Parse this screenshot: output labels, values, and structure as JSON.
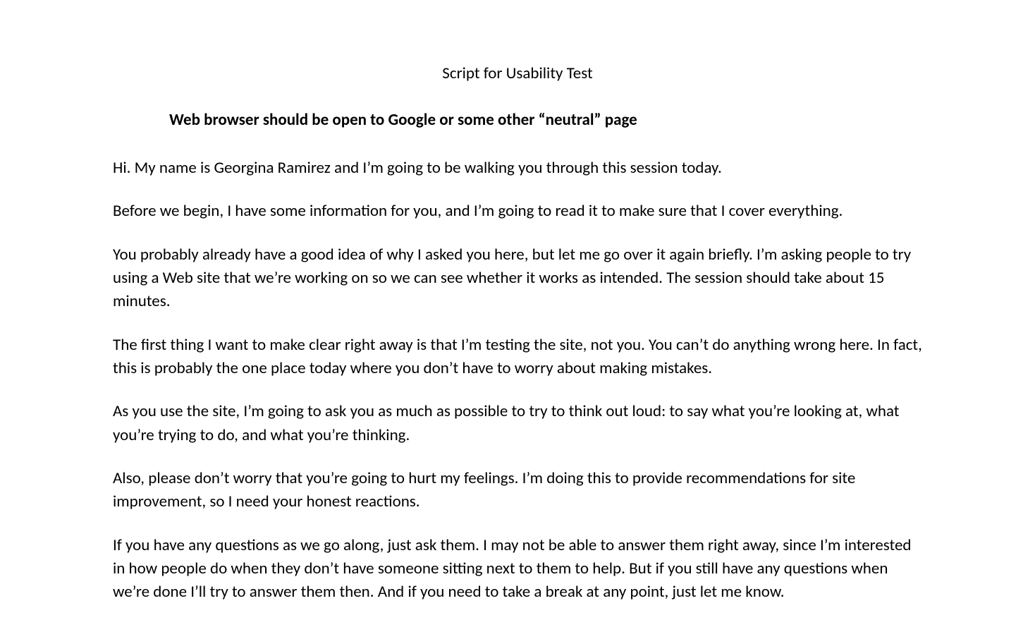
{
  "title": "Script for Usability Test",
  "instruction": "Web browser should be open to Google or some other “neutral” page",
  "paragraphs": [
    "Hi. My name is Georgina Ramirez and I’m going to be walking you through this session today.",
    "Before we begin, I have some information for you, and I’m going to read it to make sure that I cover everything.",
    "You probably already have a good idea of why I asked you here, but let me go over it again briefly. I’m asking people to try using a Web site that we’re working on so we can see whether it works as intended. The session should take about 15 minutes.",
    "The first thing I want to make clear right away is that I’m testing the site, not you. You can’t do anything wrong here. In fact, this is probably the one place today where you don’t have to worry about making mistakes.",
    "As you use the site, I’m going to ask you as much as possible to try to think out loud: to say what you’re looking at, what you’re trying to do, and what you’re thinking.",
    "Also, please don’t worry that you’re going to hurt my feelings. I’m doing this to provide recommendations for site improvement, so I need your honest reactions.",
    " If you have any questions as we go along, just ask them. I may not be able to answer them right away, since I’m interested in how people do when they don’t have someone sitting next to them to help. But if you still have any questions when we’re done I’ll try to answer them then. And if you need to take a break at any point, just let me know."
  ]
}
